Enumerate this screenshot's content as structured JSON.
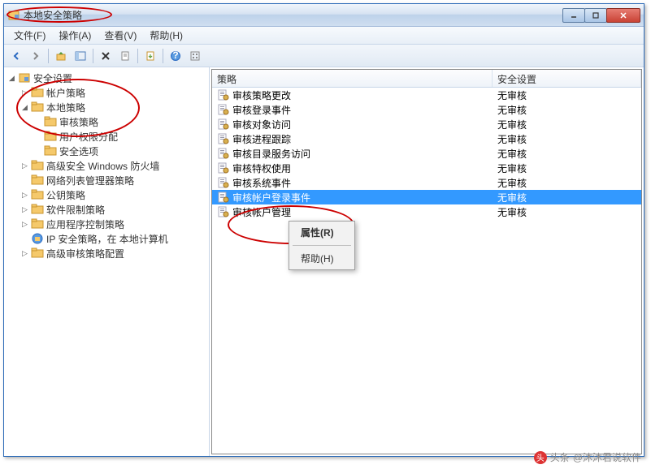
{
  "window": {
    "title": "本地安全策略"
  },
  "menubar": {
    "file": "文件(F)",
    "action": "操作(A)",
    "view": "查看(V)",
    "help": "帮助(H)"
  },
  "tree": {
    "root": "安全设置",
    "account": "帐户策略",
    "local": "本地策略",
    "audit": "审核策略",
    "userrights": "用户权限分配",
    "secoptions": "安全选项",
    "firewall": "高级安全 Windows 防火墙",
    "netlist": "网络列表管理器策略",
    "pubkey": "公钥策略",
    "softrestrict": "软件限制策略",
    "appcontrol": "应用程序控制策略",
    "ipsec": "IP 安全策略，在 本地计算机",
    "advaudit": "高级审核策略配置"
  },
  "list": {
    "header_policy": "策略",
    "header_setting": "安全设置",
    "rows": [
      {
        "policy": "审核策略更改",
        "setting": "无审核"
      },
      {
        "policy": "审核登录事件",
        "setting": "无审核"
      },
      {
        "policy": "审核对象访问",
        "setting": "无审核"
      },
      {
        "policy": "审核进程跟踪",
        "setting": "无审核"
      },
      {
        "policy": "审核目录服务访问",
        "setting": "无审核"
      },
      {
        "policy": "审核特权使用",
        "setting": "无审核"
      },
      {
        "policy": "审核系统事件",
        "setting": "无审核"
      },
      {
        "policy": "审核帐户登录事件",
        "setting": "无审核"
      },
      {
        "policy": "审核帐户管理",
        "setting": "无审核"
      }
    ]
  },
  "context_menu": {
    "properties": "属性(R)",
    "help": "帮助(H)"
  },
  "watermark": {
    "prefix": "头条",
    "text": "@沐沐君说软件"
  }
}
